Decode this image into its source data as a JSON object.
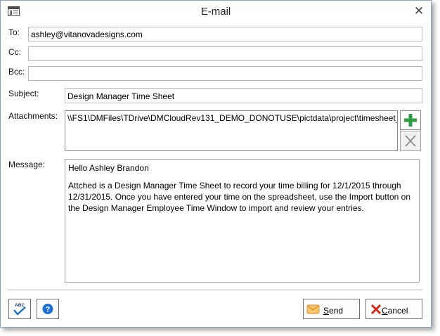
{
  "window": {
    "title": "E-mail",
    "close_glyph": "✕"
  },
  "fields": {
    "to": {
      "label": "To:",
      "value": "ashley@vitanovadesigns.com"
    },
    "cc": {
      "label": "Cc:",
      "value": ""
    },
    "bcc": {
      "label": "Bcc:",
      "value": ""
    },
    "subject": {
      "label": "Subject:",
      "value": "Design Manager Time Sheet"
    },
    "attachments": {
      "label": "Attachments:",
      "value": "\\\\FS1\\DMFiles\\TDrive\\DMCloudRev131_DEMO_DONOTUSE\\pictdata\\project\\timesheet_["
    },
    "message": {
      "label": "Message:",
      "greeting": "Hello Ashley Brandon",
      "body": "Attched is a Design Manager Time Sheet to record your time billing for 12/1/2015 through 12/31/2015.  Once you have entered your time on the spreadsheet, use the Import button on the Design Manager Employee Time Window to import and review your entries."
    }
  },
  "buttons": {
    "send": {
      "accel": "S",
      "rest": "end"
    },
    "cancel": {
      "accel": "C",
      "rest": "ancel"
    },
    "spell_check_text": "ABC"
  },
  "icons": {
    "add_attachment": "plus-icon",
    "remove_attachment": "x-icon",
    "spell_check": "spell-check-icon",
    "help": "help-icon",
    "send": "envelope-icon",
    "cancel": "cancel-x-icon"
  },
  "colors": {
    "add_green": "#2e9e45",
    "cancel_red": "#d9261c",
    "help_blue": "#1f6fd1",
    "envelope_orange": "#f2a13b"
  }
}
